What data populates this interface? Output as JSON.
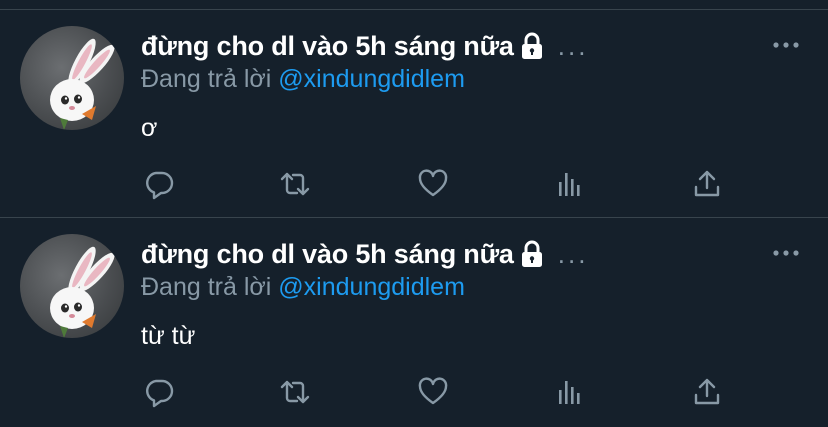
{
  "tweets": [
    {
      "display_name": "đừng cho dl vào 5h sáng nữa",
      "truncation": "...",
      "reply_prefix": "Đang trả lời",
      "reply_handle": "@xindungdidlem",
      "text": "ơ",
      "icons": [
        "rabbit-avatar",
        "lock-icon",
        "more-icon",
        "reply-icon",
        "retweet-icon",
        "like-icon",
        "analytics-icon",
        "share-icon"
      ]
    },
    {
      "display_name": "đừng cho dl vào 5h sáng nữa",
      "truncation": "...",
      "reply_prefix": "Đang trả lời",
      "reply_handle": "@xindungdidlem",
      "text": "từ từ",
      "icons": [
        "rabbit-avatar",
        "lock-icon",
        "more-icon",
        "reply-icon",
        "retweet-icon",
        "like-icon",
        "analytics-icon",
        "share-icon"
      ]
    }
  ],
  "colors": {
    "background": "#15202b",
    "divider": "#38444d",
    "text_primary": "#ffffff",
    "text_secondary": "#8899a6",
    "accent": "#1d9bf0"
  }
}
